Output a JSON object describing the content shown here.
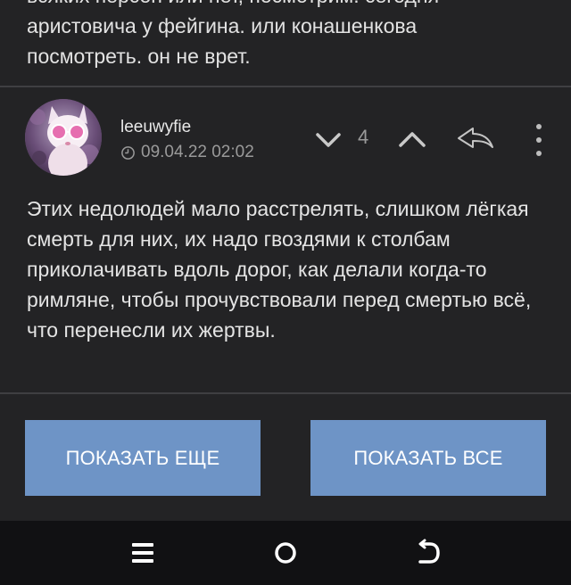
{
  "previous_comment": {
    "text_line_1": "всяких персон или нет, посмотрим. сегодня",
    "text_line_2": "аристовича у фейгина. или конашенкова",
    "text_line_3": "посмотреть. он не врет."
  },
  "comment": {
    "username": "leeuwyfie",
    "timestamp": "09.04.22 02:02",
    "vote_count": "4",
    "text": "Этих недолюдей мало расстрелять, слишком лёгкая смерть для них, их надо гвоздями к столбам приколачивать вдоль дорог, как делали когда-то римляне, чтобы прочувствовали перед смертью всё, что перенесли их жертвы.",
    "icons": {
      "clock": "clock-icon",
      "downvote": "chevron-down-icon",
      "upvote": "chevron-up-icon",
      "reply": "reply-arrow-icon",
      "more": "vertical-dots-icon"
    }
  },
  "buttons": {
    "show_more": "ПОКАЗАТЬ ЕЩЕ",
    "show_all": "ПОКАЗАТЬ ВСЕ"
  },
  "navbar": {
    "icons": [
      "menu-lines-icon",
      "home-circle-icon",
      "back-arrow-icon"
    ]
  },
  "colors": {
    "background": "#232325",
    "button": "#6e94c6",
    "navbar": "#111113",
    "muted_text": "#9a9a9a"
  }
}
